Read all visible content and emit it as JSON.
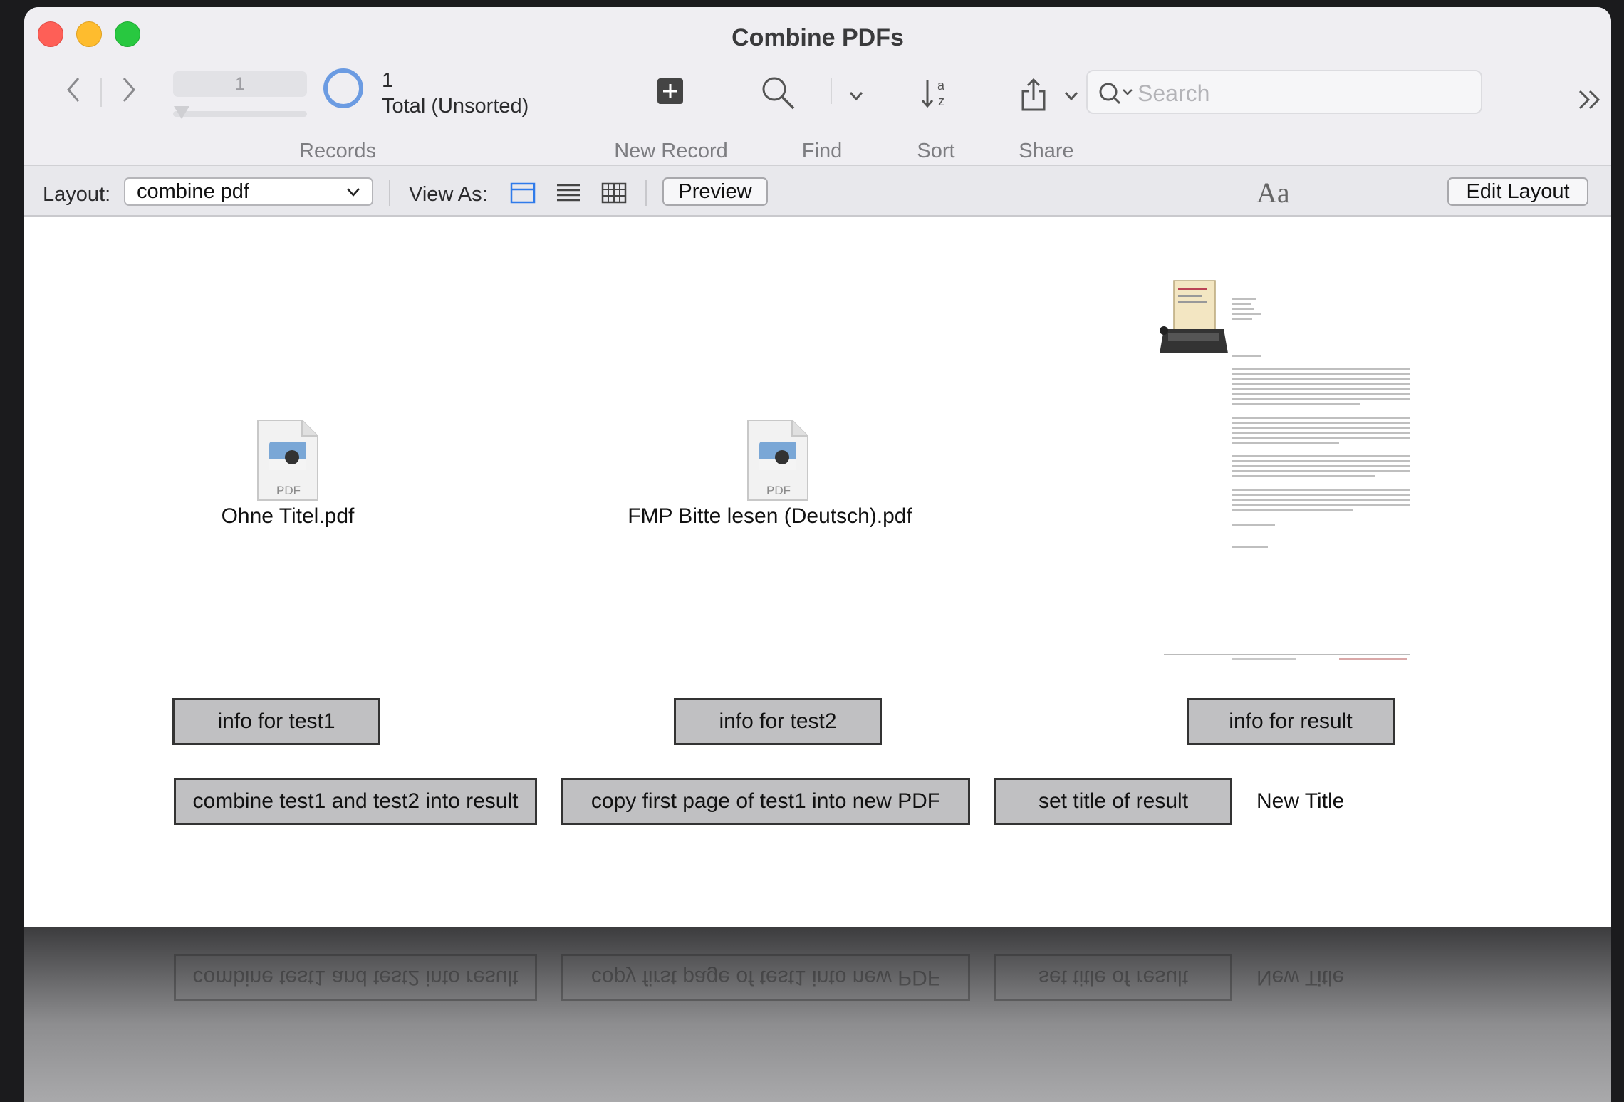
{
  "window": {
    "title": "Combine PDFs"
  },
  "toolbar": {
    "record_field": "1",
    "found_count": "1",
    "total_label": "Total (Unsorted)",
    "records_label": "Records",
    "new_record_label": "New Record",
    "find_label": "Find",
    "sort_label": "Sort",
    "share_label": "Share",
    "search_placeholder": "Search"
  },
  "layoutbar": {
    "layout_label": "Layout:",
    "layout_value": "combine pdf",
    "view_as_label": "View As:",
    "preview_label": "Preview",
    "edit_layout_label": "Edit Layout",
    "font_size_glyph": "Aa"
  },
  "content": {
    "file1": "Ohne Titel.pdf",
    "file2": "FMP Bitte lesen (Deutsch).pdf",
    "pdf_badge": "PDF",
    "btn_info_test1": "info for test1",
    "btn_info_test2": "info for test2",
    "btn_info_result": "info for result",
    "btn_combine": "combine test1 and test2 into result",
    "btn_copy": "copy first page of test1 into new PDF",
    "btn_set_title": "set title of result",
    "new_title": "New Title"
  },
  "colors": {
    "accent": "#6b9be2",
    "close": "#fe5f57",
    "minimize": "#febc2e",
    "zoom": "#28c840",
    "button_gray": "#c0c0c2"
  }
}
